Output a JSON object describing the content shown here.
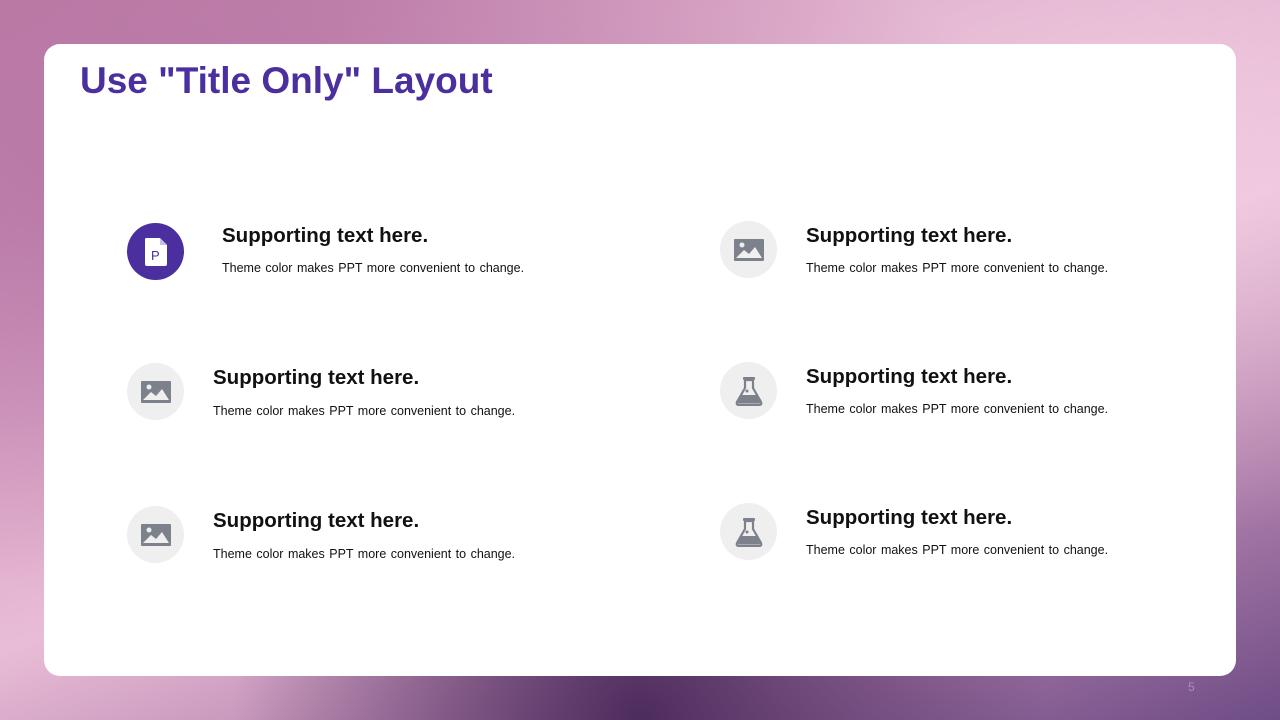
{
  "slide": {
    "title": "Use \"Title Only\" Layout",
    "page_number": "5",
    "accent_color": "#4b2f9e",
    "icon_bg_color": "#efefef",
    "icon_gray_color": "#7d818c"
  },
  "items": [
    {
      "icon": "powerpoint-file-icon",
      "heading": "Supporting text here.",
      "body": "Theme color makes PPT more convenient  to change."
    },
    {
      "icon": "image-icon",
      "heading": "Supporting text here.",
      "body": "Theme color makes PPT more convenient  to change."
    },
    {
      "icon": "image-icon",
      "heading": "Supporting text here.",
      "body": "Theme color makes PPT more convenient  to change."
    },
    {
      "icon": "image-icon",
      "heading": "Supporting text here.",
      "body": "Theme color makes PPT more convenient  to change."
    },
    {
      "icon": "flask-icon",
      "heading": "Supporting text here.",
      "body": "Theme color makes PPT more convenient  to change."
    },
    {
      "icon": "flask-icon",
      "heading": "Supporting text here.",
      "body": "Theme color makes PPT more convenient  to change."
    }
  ]
}
